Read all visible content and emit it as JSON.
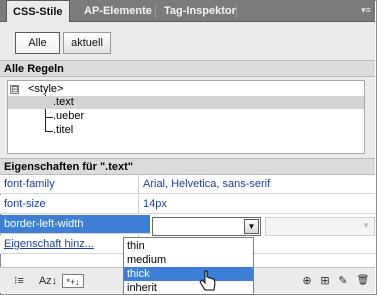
{
  "tabs": [
    {
      "label": "CSS-Stile"
    },
    {
      "label": "AP-Elemente"
    },
    {
      "label": "Tag-Inspektor"
    }
  ],
  "toolbar": {
    "all_label": "Alle",
    "current_label": "aktuell"
  },
  "rules": {
    "header": "Alle Regeln",
    "root": "<style>",
    "root_expander": "⊟",
    "items": [
      {
        "label": ".text",
        "selected": true
      },
      {
        "label": ".ueber",
        "selected": false
      },
      {
        "label": ".titel",
        "selected": false
      }
    ]
  },
  "properties": {
    "header": "Eigenschaften für \".text\"",
    "rows": [
      {
        "name": "font-family",
        "value": "Arial, Helvetica, sans-serif"
      },
      {
        "name": "font-size",
        "value": "14px"
      },
      {
        "name": "border-left-width",
        "value": ""
      }
    ],
    "add_property_label": "Eigenschaft hinz..."
  },
  "dropdown": {
    "options": [
      "thin",
      "medium",
      "thick",
      "inherit"
    ],
    "highlighted": "thick"
  },
  "colors": {
    "selection": "#3d7fd6",
    "link": "#1b3fa6",
    "tab_bar": "#7b7b7b"
  },
  "bottom_icons": [
    {
      "name": "category-view-icon",
      "glyph": "⁝≡"
    },
    {
      "name": "alphabetical-view-icon",
      "glyph": "Az↓"
    },
    {
      "name": "set-properties-view-icon",
      "glyph": "*+↓"
    },
    {
      "name": "attach-style-sheet-icon",
      "glyph": "⊕"
    },
    {
      "name": "new-css-rule-icon",
      "glyph": "⊞"
    },
    {
      "name": "edit-style-icon",
      "glyph": "✎"
    },
    {
      "name": "delete-icon",
      "glyph": "🗑"
    }
  ]
}
